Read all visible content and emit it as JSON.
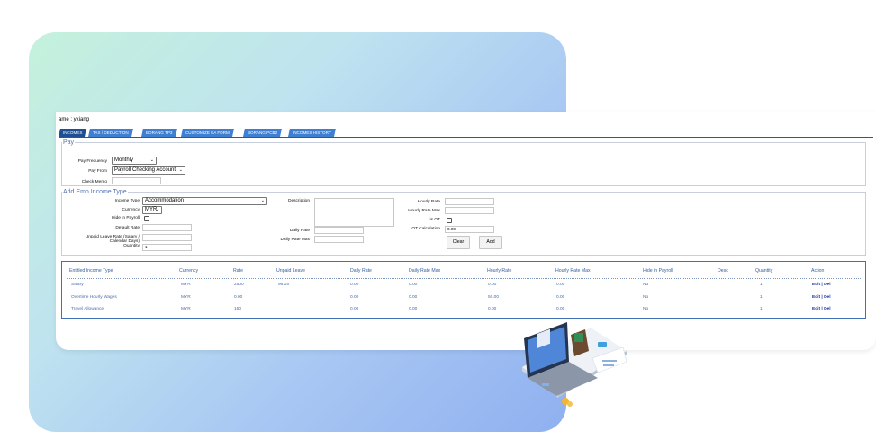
{
  "name_line": "ame : yxiang",
  "tabs": [
    "INCOMES",
    "TAX / DEDUCTION",
    "BORANG TP3",
    "CUSTOMIZE EA FORM",
    "BORANG PCB2",
    "INCOMES HISTORY"
  ],
  "pay": {
    "legend": "Pay",
    "frequency_label": "Pay Frequency",
    "frequency_value": "Monthly",
    "from_label": "Pay From",
    "from_value": "Payroll Checking Account",
    "memo_label": "Check Memo",
    "memo_value": ""
  },
  "add": {
    "legend": "Add Emp Income Type",
    "income_type_label": "Income Type",
    "income_type_value": "Accommodation",
    "currency_label": "Currency",
    "currency_value": "MYR",
    "hide_label": "Hide in Payroll",
    "default_rate_label": "Default Rate",
    "unpaid_label_1": "Unpaid Leave Rate (Salary /",
    "unpaid_label_2": "Calendar Days)",
    "quantity_label": "Quantity",
    "quantity_value": "1",
    "description_label": "Description",
    "daily_rate_label": "Daily Rate",
    "daily_rate_max_label": "Daily Rate Max",
    "hourly_rate_label": "Hourly Rate",
    "hourly_rate_max_label": "Hourly Rate Max",
    "is_ot_label": "is OT",
    "ot_calc_label": "OT Calculation",
    "ot_calc_value": "0.00",
    "clear_button": "Clear",
    "add_button": "Add"
  },
  "table": {
    "headers": [
      "Entitled Income Type",
      "Currency",
      "Rate",
      "Unpaid Leave",
      "Daily Rate",
      "Daily Rate Max",
      "Hourly Rate",
      "Hourly Rate Max",
      "Hide in Payroll",
      "Desc",
      "Quantity",
      "Action"
    ],
    "rows": [
      [
        "Salary",
        "MYR",
        "2500",
        "96.15",
        "0.00",
        "0.00",
        "0.00",
        "0.00",
        "No",
        "",
        "1",
        "Edit | Del"
      ],
      [
        "Overtime Hourly Wages",
        "MYR",
        "0.00",
        "",
        "0.00",
        "0.00",
        "50.00",
        "0.00",
        "No",
        "",
        "1",
        "Edit | Del"
      ],
      [
        "Travel Allowance",
        "MYR",
        "150",
        "",
        "0.00",
        "0.00",
        "0.00",
        "0.00",
        "No",
        "",
        "1",
        "Edit | Del"
      ]
    ]
  },
  "colors": {
    "tab": "#3f7fd2",
    "tab_active": "#1f4f93",
    "table_border": "#3f6fb5",
    "gradient_start": "#c4f1dc",
    "gradient_end": "#8fb0f0"
  },
  "illustration": "payroll-laptop-illustration"
}
